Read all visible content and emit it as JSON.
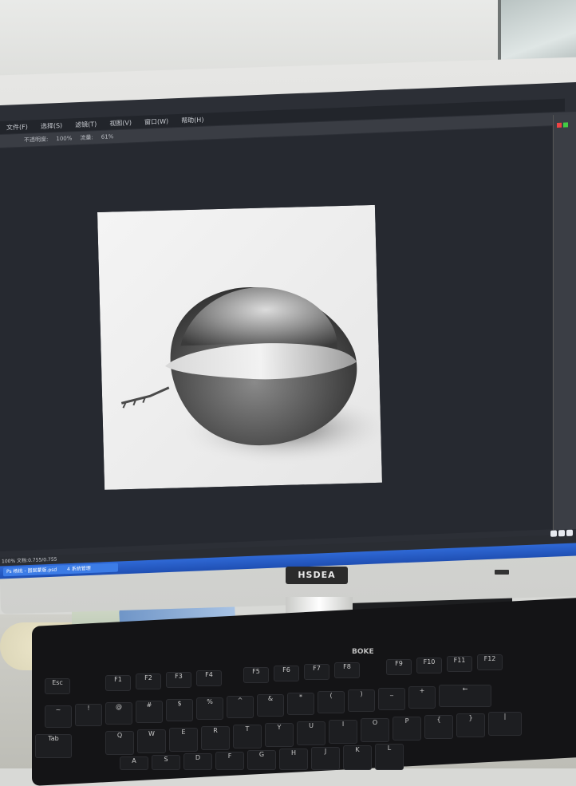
{
  "screen": {
    "menubar": [
      "文件(F)",
      "选择(S)",
      "滤镜(T)",
      "视图(V)",
      "窗口(W)",
      "帮助(H)"
    ],
    "optionsbar": [
      "不透明度:",
      "100%",
      "流量:",
      "61%"
    ],
    "status": "100% 文档:0.755/0.755",
    "taskbar_items": [
      "Ps 杨桃 - 图层蒙版.psd",
      "4 系统管理"
    ]
  },
  "monitor": {
    "brand": "HSDEA"
  },
  "keyboard": {
    "brand": "BOKE",
    "keys": [
      "Esc",
      "F1",
      "F2",
      "F3",
      "F4",
      "F5",
      "F6",
      "F7",
      "F8",
      "F9",
      "F10",
      "F11",
      "F12",
      "~",
      "!",
      "@",
      "#",
      "$",
      "%",
      "^",
      "&",
      "*",
      "(",
      ")",
      "_",
      "+",
      "←",
      "Tab",
      "Q",
      "W",
      "E",
      "R",
      "T",
      "Y",
      "U",
      "I",
      "O",
      "P",
      "{",
      "}",
      "|",
      "A",
      "S",
      "D",
      "F",
      "G",
      "H",
      "J",
      "K",
      "L"
    ]
  },
  "colors": {
    "photoshop_bg": "#2c2f36",
    "taskbar": "#1f4fb3",
    "keyboard": "#141416"
  },
  "icons": {
    "monitor_power": "power-led-icon",
    "tray": "system-tray-icons"
  }
}
